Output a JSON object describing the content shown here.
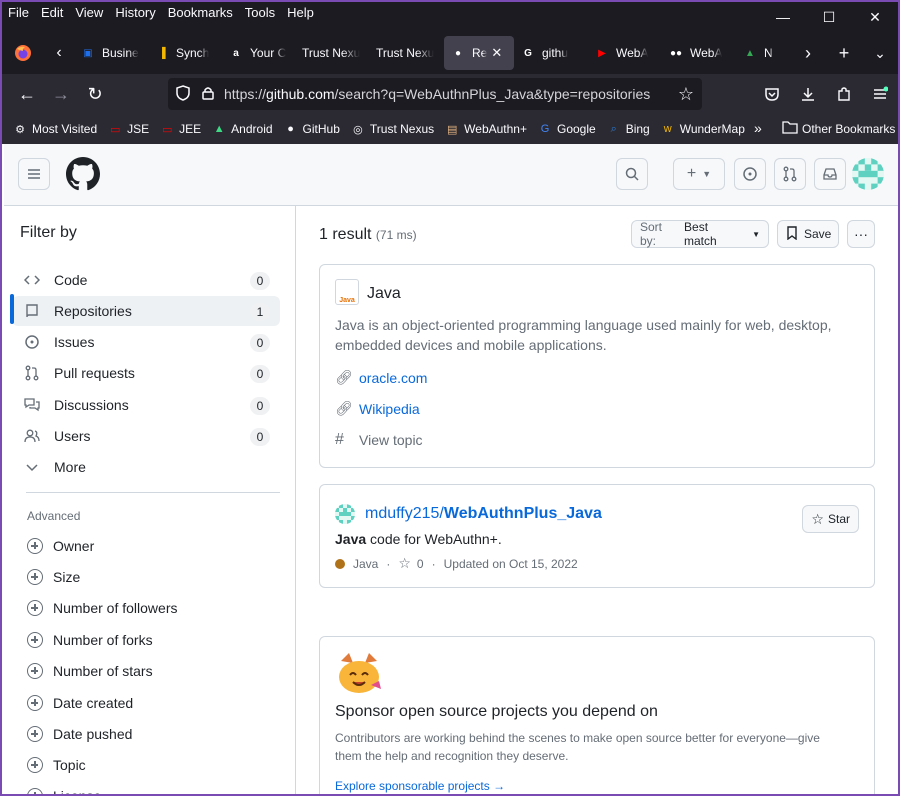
{
  "menubar": {
    "items": [
      "File",
      "Edit",
      "View",
      "History",
      "Bookmarks",
      "Tools",
      "Help"
    ],
    "minimize": "—",
    "maximize": "☐",
    "close": "✕"
  },
  "tabs": [
    {
      "label": "Busine",
      "icon": "briefcase-icon",
      "color": "#1f6feb"
    },
    {
      "label": "Synch",
      "icon": "bar-icon",
      "color": "#f5b800"
    },
    {
      "label": "Your C",
      "icon": "amazon-icon",
      "color": "#ffffff"
    },
    {
      "label": "Trust Nexu",
      "icon": "",
      "color": ""
    },
    {
      "label": "Trust Nexu",
      "icon": "",
      "color": ""
    },
    {
      "label": "Re",
      "icon": "github-icon",
      "color": "#ffffff",
      "active": true
    },
    {
      "label": "githu",
      "icon": "google-icon",
      "color": "#ffffff"
    },
    {
      "label": "WebA",
      "icon": "youtube-icon",
      "color": "#ff0000"
    },
    {
      "label": "WebA",
      "icon": "medium-icon",
      "color": "#ffffff"
    },
    {
      "label": "N",
      "icon": "drive-icon",
      "color": "#34a853"
    }
  ],
  "navbar": {
    "url_prefix": "https://",
    "url_host": "github.com",
    "url_rest": "/search?q=WebAuthnPlus_Java&type=repositories"
  },
  "bookmarks": [
    {
      "label": "Most Visited",
      "icon": "gear-icon"
    },
    {
      "label": "JSE",
      "icon": "oracle-icon"
    },
    {
      "label": "JEE",
      "icon": "oracle-icon"
    },
    {
      "label": "Android",
      "icon": "android-icon"
    },
    {
      "label": "GitHub",
      "icon": "github-icon"
    },
    {
      "label": "Trust Nexus",
      "icon": "globe-icon"
    },
    {
      "label": "WebAuthn+",
      "icon": "image-icon"
    },
    {
      "label": "Google",
      "icon": "google-icon"
    },
    {
      "label": "Bing",
      "icon": "search-icon"
    },
    {
      "label": "WunderMap",
      "icon": "wunder-icon"
    }
  ],
  "bookmarks_other": "Other Bookmarks",
  "sidebar": {
    "title": "Filter by",
    "items": [
      {
        "label": "Code",
        "count": "0",
        "icon": "code-icon"
      },
      {
        "label": "Repositories",
        "count": "1",
        "icon": "repo-icon",
        "selected": true
      },
      {
        "label": "Issues",
        "count": "0",
        "icon": "issue-icon"
      },
      {
        "label": "Pull requests",
        "count": "0",
        "icon": "pull-request-icon"
      },
      {
        "label": "Discussions",
        "count": "0",
        "icon": "discussion-icon"
      },
      {
        "label": "Users",
        "count": "0",
        "icon": "users-icon"
      },
      {
        "label": "More",
        "count": "",
        "icon": "chevron-down-icon"
      }
    ],
    "advanced_title": "Advanced",
    "advanced": [
      "Owner",
      "Size",
      "Number of followers",
      "Number of forks",
      "Number of stars",
      "Date created",
      "Date pushed",
      "Topic",
      "License"
    ]
  },
  "main": {
    "result_count": "1 result",
    "result_time": "(71 ms)",
    "sort_prefix": "Sort by:",
    "sort_value": "Best match",
    "save_label": "Save",
    "topic": {
      "title": "Java",
      "logo_text": "Java",
      "description": "Java is an object-oriented programming language used mainly for web, desktop, embedded devices and mobile applications.",
      "links": [
        "oracle.com",
        "Wikipedia"
      ],
      "view_topic": "View topic"
    },
    "repo": {
      "owner": "mduffy215/",
      "name": "WebAuthnPlus_Java",
      "desc_bold": "Java",
      "desc_rest": " code for WebAuthn+.",
      "language": "Java",
      "stars": "0",
      "updated": "Updated on Oct 15, 2022",
      "star_label": "Star",
      "sep": "·"
    },
    "sponsor": {
      "title": "Sponsor open source projects you depend on",
      "description": "Contributors are working behind the scenes to make open source better for everyone—give them the help and recognition they deserve.",
      "link": "Explore sponsorable projects →"
    }
  }
}
